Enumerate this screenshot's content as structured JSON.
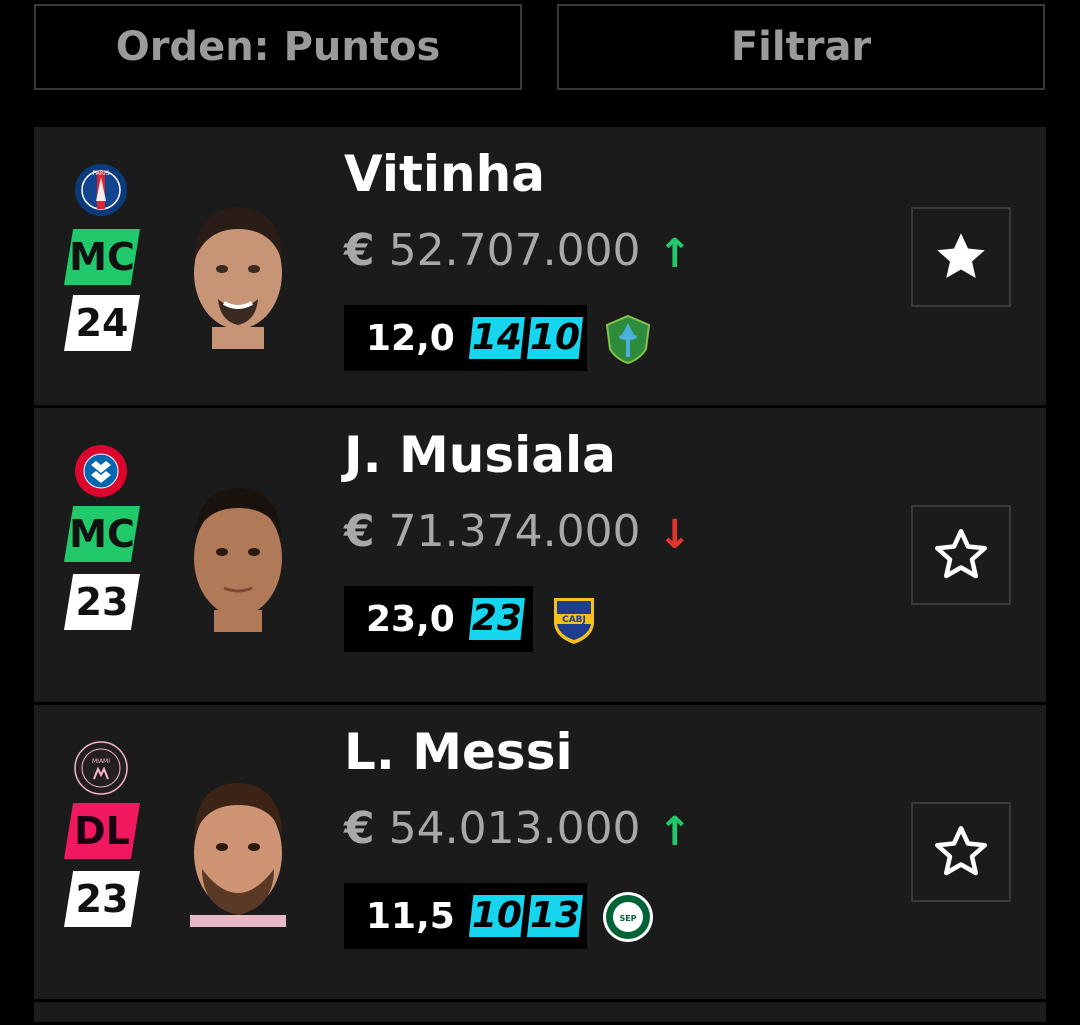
{
  "toolbar": {
    "order_label": "Orden: Puntos",
    "filter_label": "Filtrar"
  },
  "players": [
    {
      "name": "Vitinha",
      "club": "PSG",
      "position": "MC",
      "rating": "24",
      "currency": "€",
      "value": "52.707.000",
      "trend": "up",
      "trend_symbol": "↑",
      "average": "12,0",
      "recent_scores": [
        "14",
        "10"
      ],
      "next_opponent": "Seattle Sounders",
      "favorite": true
    },
    {
      "name": "J. Musiala",
      "club": "FC Bayern München",
      "position": "MC",
      "rating": "23",
      "currency": "€",
      "value": "71.374.000",
      "trend": "down",
      "trend_symbol": "↓",
      "average": "23,0",
      "recent_scores": [
        "23"
      ],
      "next_opponent": "CABJ",
      "favorite": false
    },
    {
      "name": "L. Messi",
      "club": "Inter Miami",
      "position": "DL",
      "rating": "23",
      "currency": "€",
      "value": "54.013.000",
      "trend": "up",
      "trend_symbol": "↑",
      "average": "11,5",
      "recent_scores": [
        "10",
        "13"
      ],
      "next_opponent": "Palmeiras",
      "favorite": false
    }
  ],
  "colors": {
    "mc": "#21c96b",
    "dl": "#f0195f",
    "score": "#17d4ef",
    "up": "#21c96b",
    "down": "#e0352b"
  }
}
